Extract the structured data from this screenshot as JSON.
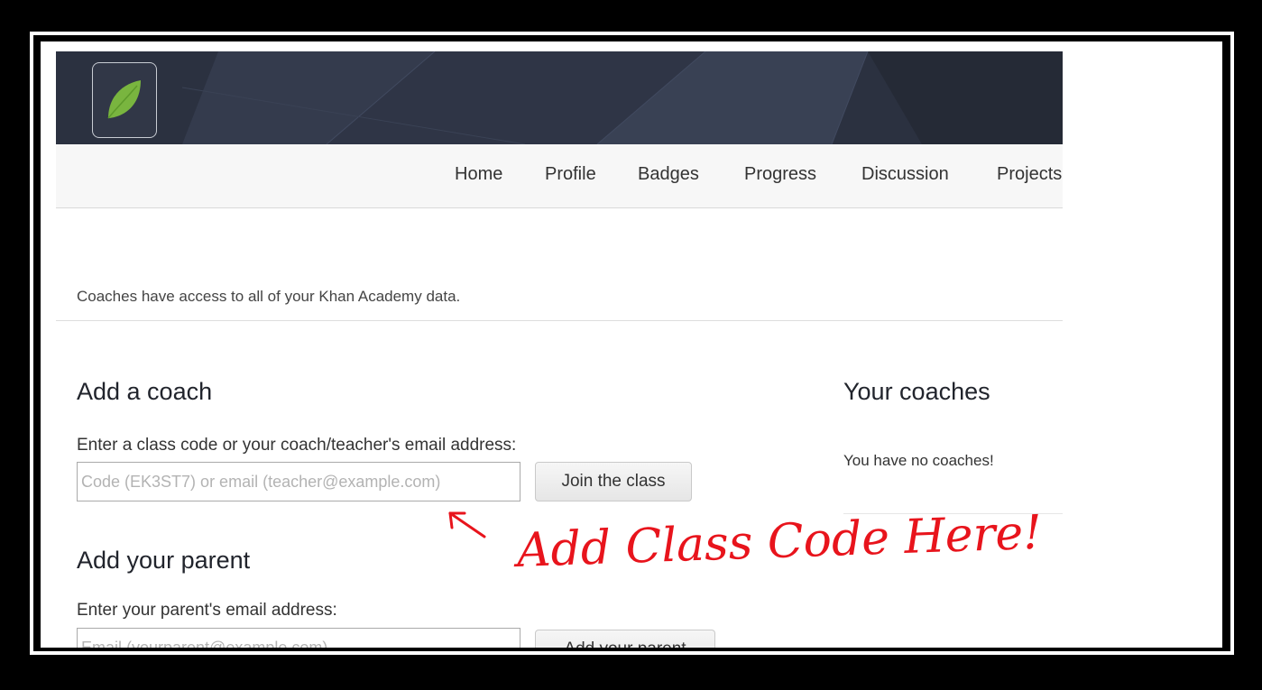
{
  "nav": {
    "items": [
      "Home",
      "Profile",
      "Badges",
      "Progress",
      "Discussion",
      "Projects"
    ]
  },
  "info": {
    "text": "Coaches have access to all of your Khan Academy data."
  },
  "add_coach": {
    "title": "Add a coach",
    "label": "Enter a class code or your coach/teacher's email address:",
    "placeholder": "Code (EK3ST7) or email (teacher@example.com)",
    "button": "Join the class"
  },
  "your_coaches": {
    "title": "Your coaches",
    "empty_text": "You have no coaches!"
  },
  "add_parent": {
    "title": "Add your parent",
    "label": "Enter your parent's email address:",
    "placeholder": "Email (yourparent@example.com)",
    "button": "Add your parent"
  },
  "annotation": {
    "text": "Add  Class Code Here!"
  },
  "colors": {
    "brand_green": "#79b53f",
    "annotation_red": "#e8141c",
    "banner": "#2b3140"
  }
}
